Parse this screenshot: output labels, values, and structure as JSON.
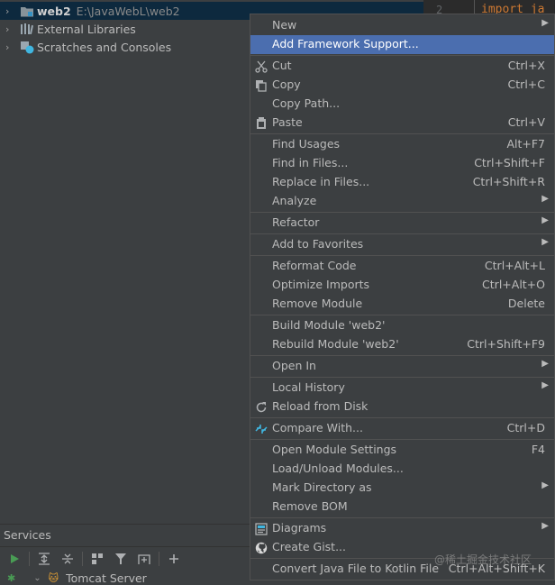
{
  "project_tree": {
    "root_label": "web2",
    "root_path": "E:\\JavaWebL\\web2",
    "external_libraries": "External Libraries",
    "scratches": "Scratches and Consoles"
  },
  "editor": {
    "line_number": "2",
    "code_text": "import ja"
  },
  "menu": {
    "new": {
      "label": "New"
    },
    "add_framework": {
      "label": "Add Framework Support..."
    },
    "cut": {
      "label": "Cut",
      "shortcut": "Ctrl+X"
    },
    "copy": {
      "label": "Copy",
      "shortcut": "Ctrl+C"
    },
    "copy_path": {
      "label": "Copy Path..."
    },
    "paste": {
      "label": "Paste",
      "shortcut": "Ctrl+V"
    },
    "find_usages": {
      "label": "Find Usages",
      "shortcut": "Alt+F7"
    },
    "find_in_files": {
      "label": "Find in Files...",
      "shortcut": "Ctrl+Shift+F"
    },
    "replace_in_files": {
      "label": "Replace in Files...",
      "shortcut": "Ctrl+Shift+R"
    },
    "analyze": {
      "label": "Analyze"
    },
    "refactor": {
      "label": "Refactor"
    },
    "add_to_favorites": {
      "label": "Add to Favorites"
    },
    "reformat_code": {
      "label": "Reformat Code",
      "shortcut": "Ctrl+Alt+L"
    },
    "optimize_imports": {
      "label": "Optimize Imports",
      "shortcut": "Ctrl+Alt+O"
    },
    "remove_module": {
      "label": "Remove Module",
      "shortcut": "Delete"
    },
    "build_module": {
      "label": "Build Module 'web2'"
    },
    "rebuild_module": {
      "label": "Rebuild Module 'web2'",
      "shortcut": "Ctrl+Shift+F9"
    },
    "open_in": {
      "label": "Open In"
    },
    "local_history": {
      "label": "Local History"
    },
    "reload_from_disk": {
      "label": "Reload from Disk"
    },
    "compare_with": {
      "label": "Compare With...",
      "shortcut": "Ctrl+D"
    },
    "open_module_settings": {
      "label": "Open Module Settings",
      "shortcut": "F4"
    },
    "load_unload_modules": {
      "label": "Load/Unload Modules..."
    },
    "mark_directory_as": {
      "label": "Mark Directory as"
    },
    "remove_bom": {
      "label": "Remove BOM"
    },
    "diagrams": {
      "label": "Diagrams"
    },
    "create_gist": {
      "label": "Create Gist..."
    },
    "convert_java_kotlin": {
      "label": "Convert Java File to Kotlin File",
      "shortcut": "Ctrl+Alt+Shift+K"
    }
  },
  "services": {
    "title": "Services",
    "tomcat_label": "Tomcat Server"
  },
  "watermark": "@稀土掘金技术社区",
  "colors": {
    "selection": "#4b6eaf",
    "background": "#3c3f41",
    "editor_bg": "#2b2b2b",
    "run_green": "#499c54"
  }
}
